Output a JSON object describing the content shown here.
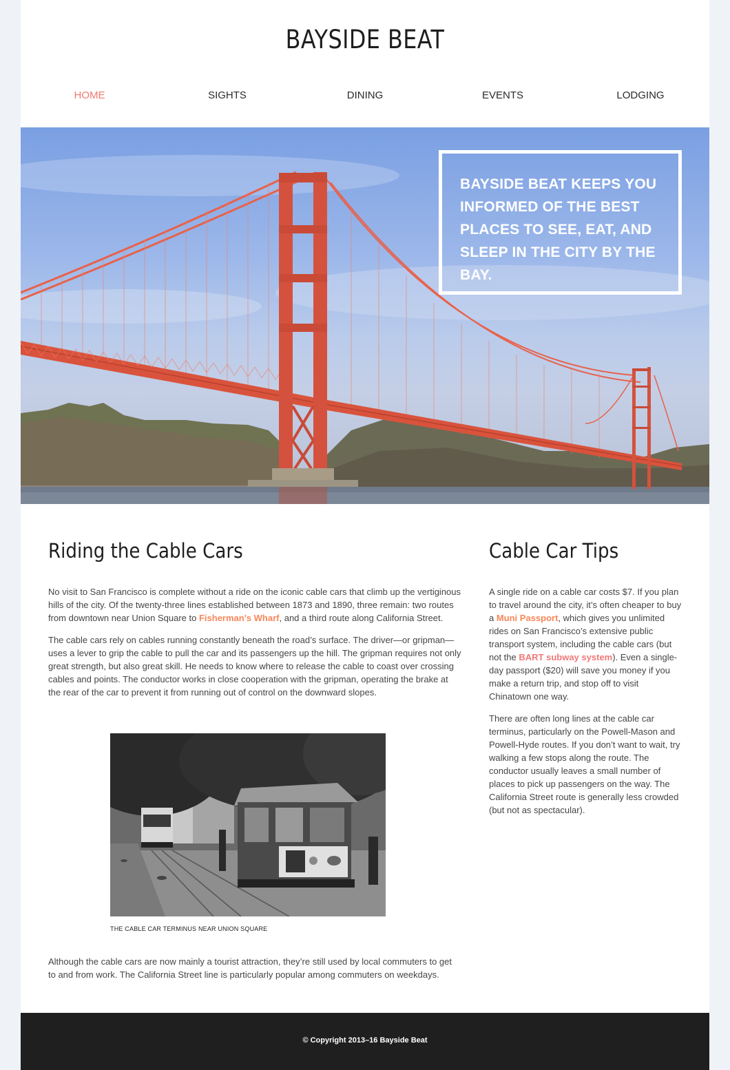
{
  "header": {
    "site_title": "BAYSIDE BEAT"
  },
  "nav": {
    "items": [
      {
        "label": "HOME",
        "active": true
      },
      {
        "label": "SIGHTS",
        "active": false
      },
      {
        "label": "DINING",
        "active": false
      },
      {
        "label": "EVENTS",
        "active": false
      },
      {
        "label": "LODGING",
        "active": false
      }
    ]
  },
  "hero": {
    "image_alt": "Golden Gate Bridge",
    "tagline": "BAYSIDE BEAT KEEPS YOU INFORMED OF THE BEST PLACES TO SEE, EAT, AND SLEEP IN THE CITY BY THE BAY."
  },
  "main": {
    "heading": "Riding the Cable Cars",
    "para1": {
      "before": "No visit to San Francisco is complete without a ride on the iconic cable cars that climb up the vertiginous hills of the city. Of the twenty-three lines established between 1873 and 1890, three remain: two routes from downtown near Union Square to ",
      "link": "Fisherman's Wharf",
      "after": ", and a third route along California Street."
    },
    "para2": "The cable cars rely on cables running constantly beneath the road’s surface. The driver—or gripman—uses a lever to grip the cable to pull the car and its passengers up the hill. The gripman requires not only great strength, but also great skill. He needs to know where to release the cable to coast over crossing cables and points. The conductor works in close cooperation with the gripman, operating the brake at the rear of the car to prevent it from running out of control on the downward slopes.",
    "figure": {
      "image_alt": "Cable cars at the terminus",
      "caption": "THE CABLE CAR TERMINUS NEAR UNION SQUARE"
    },
    "para3": "Although the cable cars are now mainly a tourist attraction, they’re still used by local commuters to get to and from work. The California Street line is particularly popular among commuters on weekdays."
  },
  "sidebar": {
    "heading": "Cable Car Tips",
    "para1": {
      "part1": "A single ride on a cable car costs $7. If you plan to travel around the city, it’s often cheaper to buy a ",
      "link1": "Muni Passport",
      "part2": ", which gives you unlimited rides on San Francisco’s extensive public transport system, including the cable cars (but not the ",
      "link2": "BART subway system",
      "part3": "). Even a single-day passport ($20) will save you money if you make a return trip, and stop off to visit Chinatown one way."
    },
    "para2": "There are often long lines at the cable car terminus, particularly on the Powell-Mason and Powell-Hyde routes. If you don’t want to wait, try walking a few stops along the route. The conductor usually leaves a small number of places to pick up passengers on the way. The California Street route is generally less crowded (but not as spectacular)."
  },
  "footer": {
    "copyright": "© Copyright 2013–16 Bayside Beat"
  },
  "colors": {
    "accent_active_nav": "#f0786e",
    "link_orange": "#f7875a",
    "link_salmon": "#f07878",
    "footer_bg": "#1f1f1f",
    "page_bg": "#eff3f8"
  }
}
